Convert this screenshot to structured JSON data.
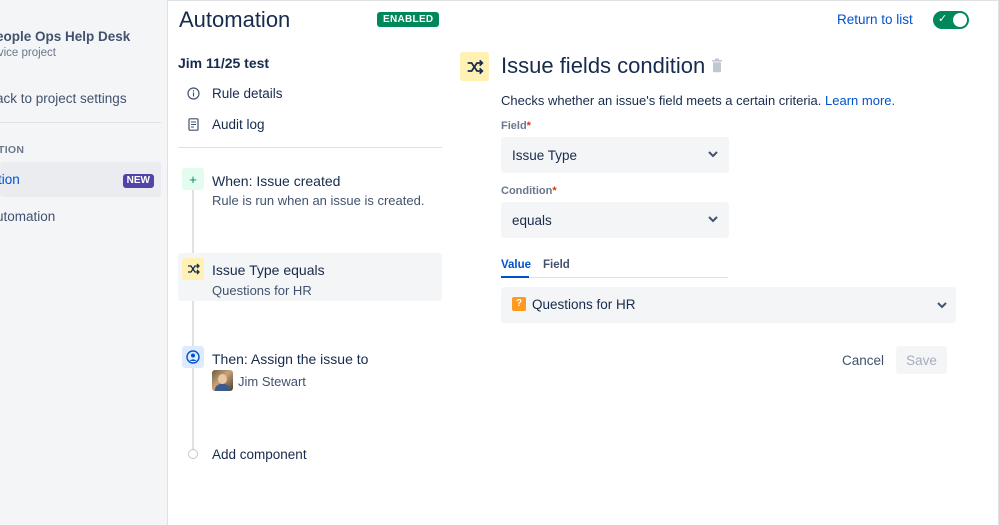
{
  "sidebar": {
    "project_name": "eople Ops Help Desk",
    "project_type": "rvice project",
    "back_link": "ack to project settings",
    "section_label": "TION",
    "active_item": "tion",
    "active_badge": "NEW",
    "item": "utomation"
  },
  "header": {
    "title": "Automation",
    "status_badge": "ENABLED",
    "return_link": "Return to list",
    "toggle_on": true
  },
  "rule": {
    "name": "Jim 11/25 test",
    "menu": [
      {
        "label": "Rule details",
        "icon": "info-icon"
      },
      {
        "label": "Audit log",
        "icon": "document-icon"
      }
    ],
    "steps": {
      "trigger": {
        "title": "When: Issue created",
        "subtitle": "Rule is run when an issue is created.",
        "icon": "plus-icon"
      },
      "condition": {
        "title": "Issue Type equals",
        "subtitle": "Questions for HR",
        "icon": "shuffle-icon"
      },
      "action": {
        "title": "Then: Assign the issue to",
        "assignee": "Jim Stewart",
        "icon": "user-icon"
      },
      "add": {
        "label": "Add component"
      }
    }
  },
  "panel": {
    "title": "Issue fields condition",
    "description": "Checks whether an issue's field meets a certain criteria.",
    "learn_more": "Learn more.",
    "field_label": "Field",
    "field_value": "Issue Type",
    "condition_label": "Condition",
    "condition_value": "equals",
    "required_mark": "*",
    "tabs": {
      "value": "Value",
      "field": "Field"
    },
    "selected_value": "Questions for HR",
    "value_icon_glyph": "?",
    "cancel": "Cancel",
    "save": "Save"
  },
  "colors": {
    "brand_blue": "#0052cc",
    "success_green": "#00875a",
    "badge_purple": "#5243aa",
    "condition_yellow": "#fff0b3"
  }
}
